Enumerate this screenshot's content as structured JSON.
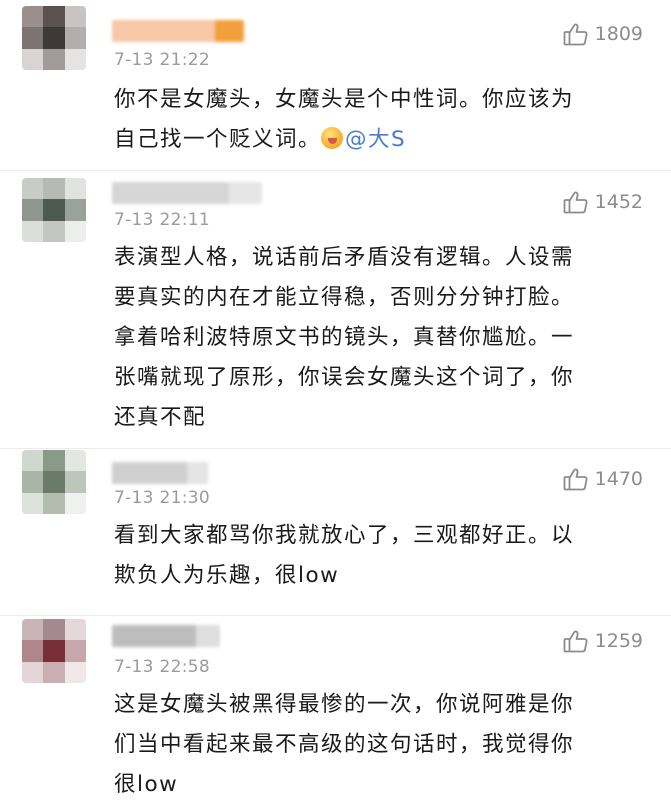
{
  "comments": [
    {
      "time": "7-13 21:22",
      "likes": "1809",
      "text_lines": [
        "你不是女魔头，女魔头是个中性词。你应该为",
        "自己找一个贬义词。"
      ],
      "mention": "@大S",
      "avatar_colors": [
        "#9a8e8e",
        "#5b5250",
        "#c9c3c3",
        "#7d7372",
        "#3e3837",
        "#b4adad",
        "#d8d4d4",
        "#a39b9a",
        "#e6e3e3"
      ],
      "name_color": "#f7c7a6",
      "name_accent": "#f2a03b"
    },
    {
      "time": "7-13 22:11",
      "likes": "1452",
      "text_lines": [
        "表演型人格，说话前后矛盾没有逻辑。人设需",
        "要真实的内在才能立得稳，否则分分钟打脸。",
        "拿着哈利波特原文书的镜头，真替你尴尬。一",
        "张嘴就现了原形，你误会女魔头这个词了，你",
        "还真不配"
      ],
      "avatar_colors": [
        "#c8ccc8",
        "#b5bab5",
        "#e1e3e1",
        "#8f968f",
        "#4c5a4f",
        "#9aa39b",
        "#dcdedc",
        "#c2c7c2",
        "#eceeec"
      ],
      "name_color": "#d6d6d6",
      "name_accent": "#e6e6e6"
    },
    {
      "time": "7-13 21:30",
      "likes": "1470",
      "text_lines": [
        "看到大家都骂你我就放心了，三观都好正。以",
        "欺负人为乐趣，很low"
      ],
      "avatar_colors": [
        "#cfd8cd",
        "#8a9a88",
        "#e2e7e1",
        "#a9b6a7",
        "#6c7a6a",
        "#bcc7ba",
        "#dde3dc",
        "#b2bdb0",
        "#eef1ed"
      ],
      "name_color": "#cfcfcf",
      "name_accent": "#e4e4e4"
    },
    {
      "time": "7-13 22:58",
      "likes": "1259",
      "text_lines": [
        "这是女魔头被黑得最惨的一次，你说阿雅是你",
        "们当中看起来最不高级的这句话时，我觉得你",
        "很low"
      ],
      "avatar_colors": [
        "#c9b5b8",
        "#a48990",
        "#e3d8da",
        "#b0868c",
        "#7a2f36",
        "#c7a7ac",
        "#e4d6d8",
        "#c9aeb2",
        "#efe7e8"
      ],
      "name_color": "#bdbdbd",
      "name_accent": "#dedede"
    }
  ]
}
